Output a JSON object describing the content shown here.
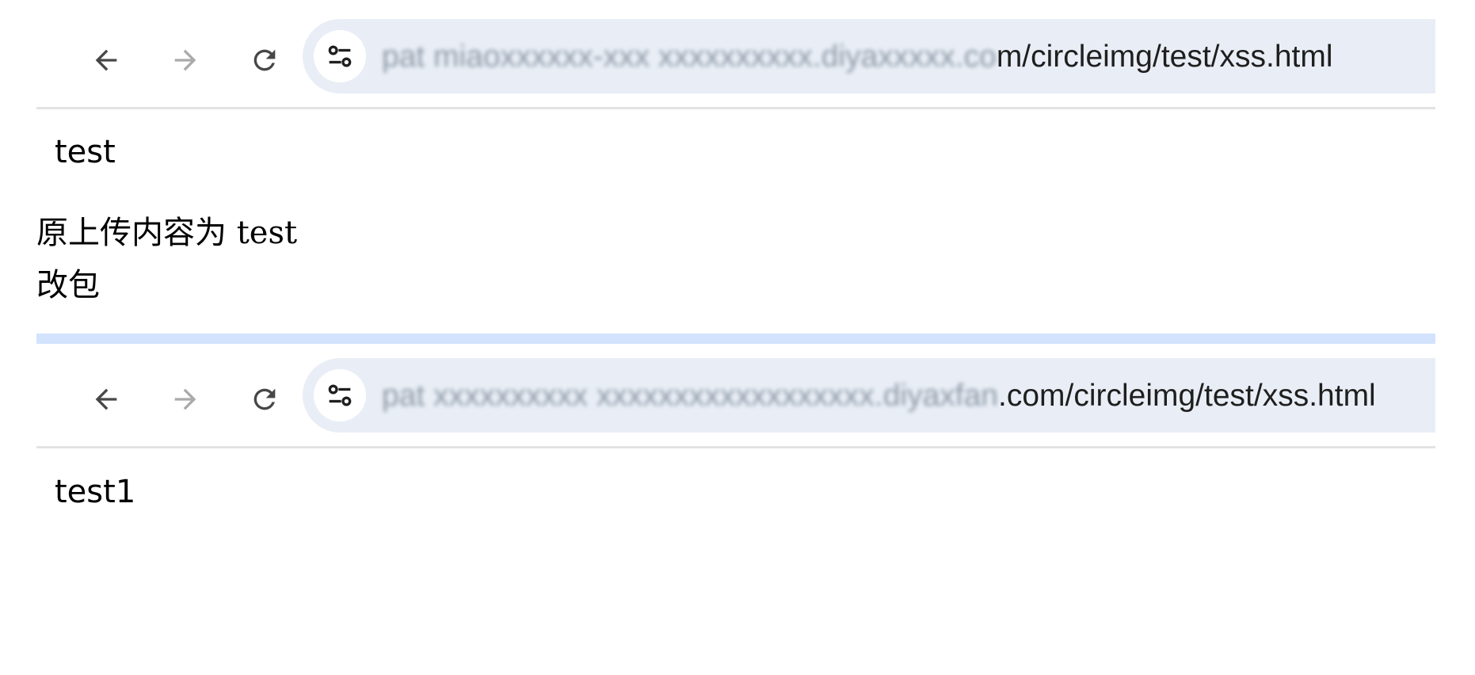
{
  "screenshot1": {
    "url_host": "pat miaoxxxxxx-xxx xxxxxxxxxx.diyaxxxxx.co",
    "url_path": "m/circleimg/test/xss.html",
    "page_text": "test",
    "icons": {
      "back": "arrow-left-icon",
      "forward": "arrow-right-icon",
      "reload": "reload-icon",
      "site_info": "tune-icon"
    }
  },
  "notes": {
    "line1": "原上传内容为 test",
    "line2": "改包"
  },
  "screenshot2": {
    "url_host": "pat xxxxxxxxxx xxxxxxxxxxxxxxxxxx.diyaxfan",
    "url_path": ".com/circleimg/test/xss.html",
    "page_text": "test1",
    "icons": {
      "back": "arrow-left-icon",
      "forward": "arrow-right-icon",
      "reload": "reload-icon",
      "site_info": "tune-icon"
    }
  },
  "colors": {
    "omnibox": "#e9eef6",
    "divider": "#e3e3e3",
    "tab_strip": "#d3e3fd",
    "icon_active": "#474747",
    "icon_disabled": "#aaaaaa"
  }
}
